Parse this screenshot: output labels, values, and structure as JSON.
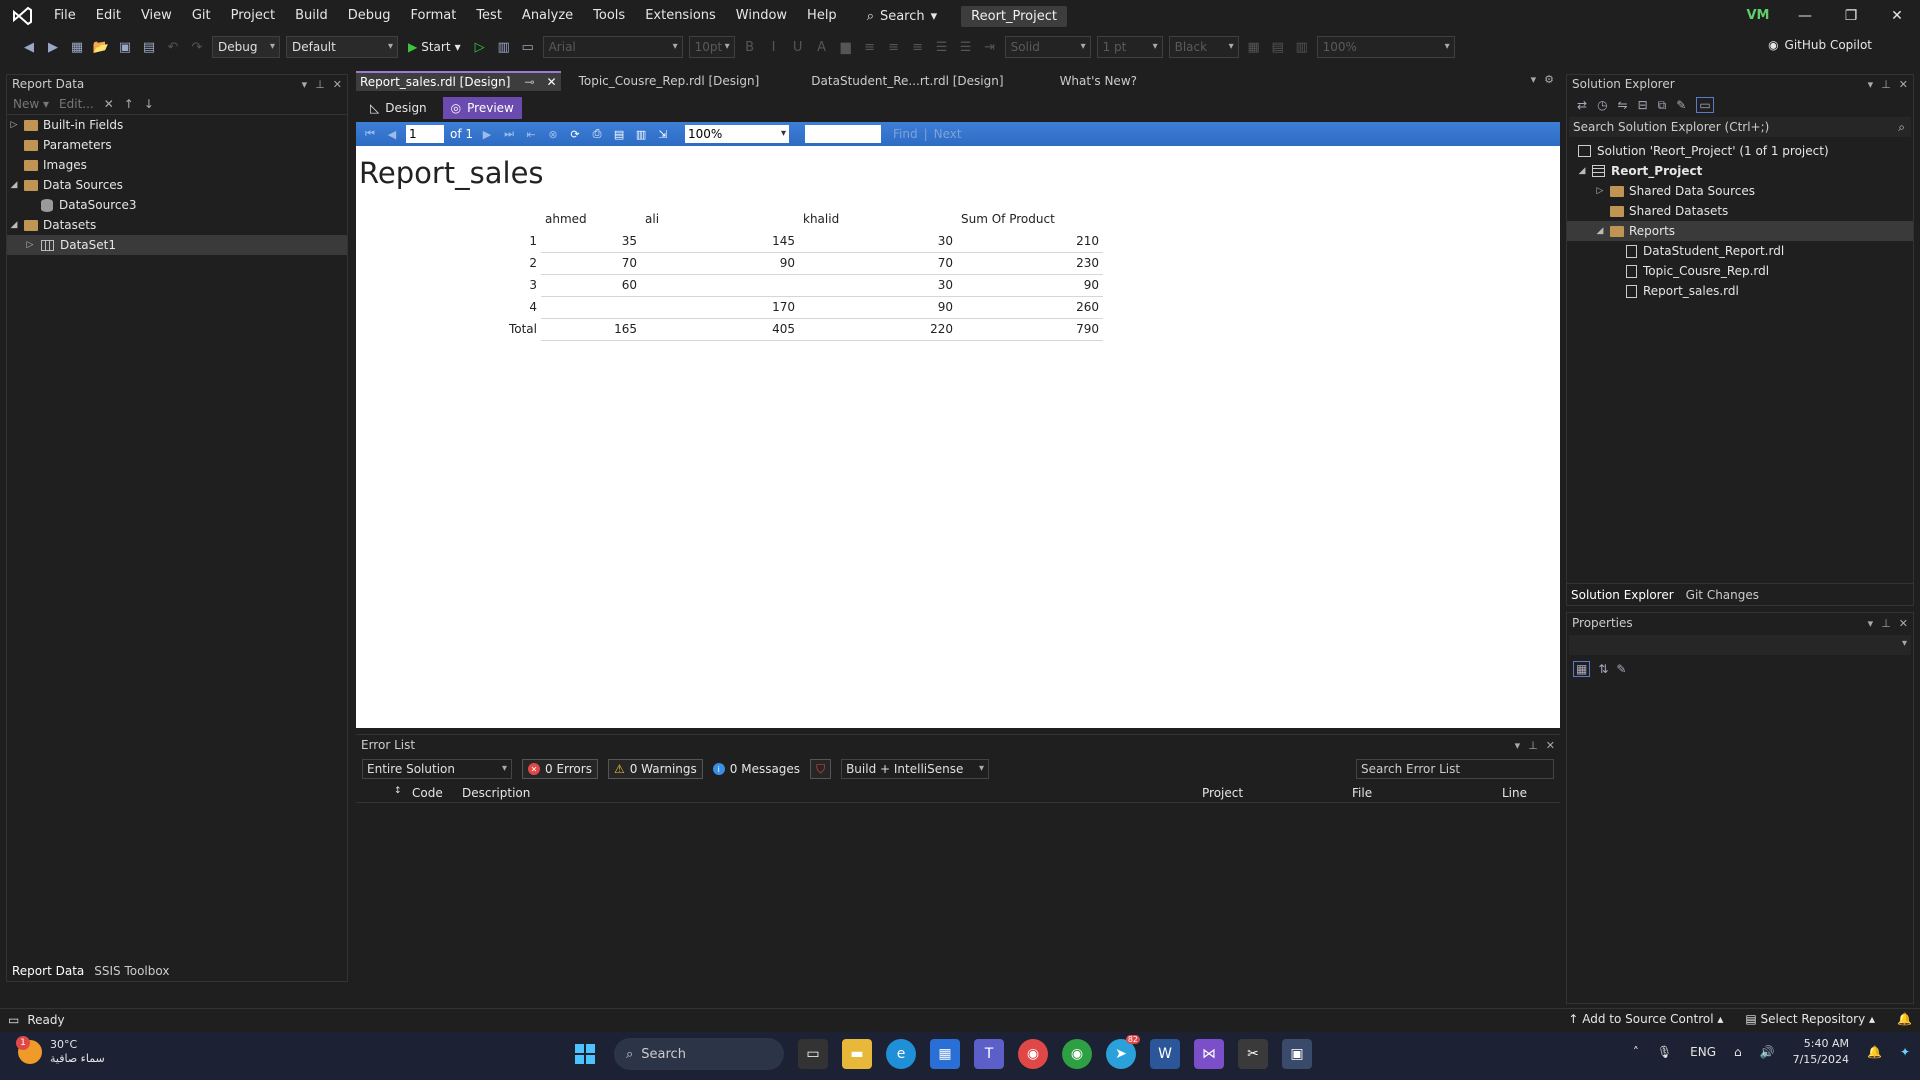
{
  "menubar": {
    "items": [
      "File",
      "Edit",
      "View",
      "Git",
      "Project",
      "Build",
      "Debug",
      "Format",
      "Test",
      "Analyze",
      "Tools",
      "Extensions",
      "Window",
      "Help"
    ],
    "search_label": "Search",
    "project_title": "Reort_Project",
    "avatar_initials": "VM"
  },
  "toolbar": {
    "config": "Debug",
    "platform": "Default",
    "start_label": "Start",
    "font_name": "Arial",
    "font_size": "10pt",
    "border_style": "Solid",
    "border_width": "1 pt",
    "border_color": "Black",
    "zoom": "100%",
    "copilot_label": "GitHub Copilot"
  },
  "report_data": {
    "title": "Report Data",
    "new_label": "New",
    "edit_label": "Edit...",
    "tree": [
      {
        "label": "Built-in Fields",
        "type": "folder",
        "expanded": false,
        "level": 0
      },
      {
        "label": "Parameters",
        "type": "folder",
        "expanded": null,
        "level": 0
      },
      {
        "label": "Images",
        "type": "folder",
        "expanded": null,
        "level": 0
      },
      {
        "label": "Data Sources",
        "type": "folder",
        "expanded": true,
        "level": 0
      },
      {
        "label": "DataSource3",
        "type": "datasource",
        "expanded": null,
        "level": 1
      },
      {
        "label": "Datasets",
        "type": "folder",
        "expanded": true,
        "level": 0
      },
      {
        "label": "DataSet1",
        "type": "dataset",
        "expanded": false,
        "level": 1
      }
    ],
    "bottom_tabs": [
      "Report Data",
      "SSIS Toolbox"
    ]
  },
  "doc_tabs": [
    {
      "label": "Report_sales.rdl [Design]",
      "active": true
    },
    {
      "label": "Topic_Cousre_Rep.rdl [Design]",
      "active": false
    },
    {
      "label": "DataStudent_Re...rt.rdl [Design]",
      "active": false
    },
    {
      "label": "What's New?",
      "active": false
    }
  ],
  "design_preview": {
    "design_label": "Design",
    "preview_label": "Preview"
  },
  "viewer": {
    "page": "1",
    "of_label": "of 1",
    "zoom": "100%",
    "find_label": "Find",
    "next_label": "Next"
  },
  "report": {
    "title": "Report_sales",
    "headers": [
      "ahmed",
      "ali",
      "khalid",
      "Sum Of Product"
    ],
    "rows": [
      {
        "label": "1",
        "values": [
          "35",
          "145",
          "30",
          "210"
        ]
      },
      {
        "label": "2",
        "values": [
          "70",
          "90",
          "70",
          "230"
        ]
      },
      {
        "label": "3",
        "values": [
          "60",
          "",
          "30",
          "90"
        ]
      },
      {
        "label": "4",
        "values": [
          "",
          "170",
          "90",
          "260"
        ]
      },
      {
        "label": "Total",
        "values": [
          "165",
          "405",
          "220",
          "790"
        ]
      }
    ]
  },
  "error_list": {
    "title": "Error List",
    "scope": "Entire Solution",
    "errors": "0 Errors",
    "warnings": "0 Warnings",
    "messages": "0 Messages",
    "filter": "Build + IntelliSense",
    "search_placeholder": "Search Error List",
    "columns": [
      "Code",
      "Description",
      "Project",
      "File",
      "Line"
    ]
  },
  "solution_explorer": {
    "title": "Solution Explorer",
    "search_placeholder": "Search Solution Explorer (Ctrl+;)",
    "solution_label": "Solution 'Reort_Project' (1 of 1 project)",
    "project_label": "Reort_Project",
    "folders": [
      "Shared Data Sources",
      "Shared Datasets",
      "Reports"
    ],
    "reports": [
      "DataStudent_Report.rdl",
      "Topic_Cousre_Rep.rdl",
      "Report_sales.rdl"
    ],
    "bottom_tabs": [
      "Solution Explorer",
      "Git Changes"
    ]
  },
  "properties": {
    "title": "Properties"
  },
  "statusbar": {
    "ready": "Ready",
    "source_control": "Add to Source Control",
    "repository": "Select Repository"
  },
  "taskbar": {
    "weather_temp": "30°C",
    "weather_desc": "سماء صافية",
    "weather_badge": "1",
    "search_label": "Search",
    "language": "ENG",
    "time": "5:40 AM",
    "date": "7/15/2024",
    "telegram_badge": "82"
  },
  "colors": {
    "accent": "#6b4bb0",
    "viewer_bar": "#2e6cc4",
    "play": "#3cc43c",
    "error": "#e04848",
    "warning": "#e8c13a"
  }
}
